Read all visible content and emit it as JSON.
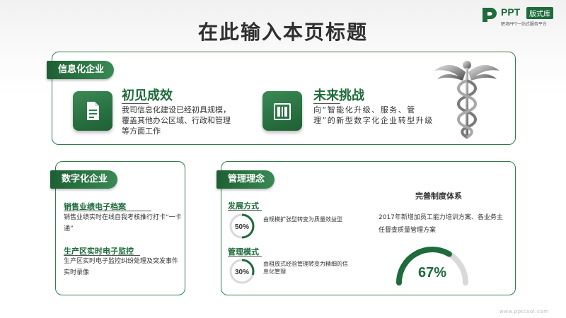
{
  "page": {
    "title": "在此输入本页标题",
    "footer_url": "www.pptcool.com"
  },
  "logo": {
    "brand": "PPT",
    "badge": "版式库",
    "subtitle": "职场PPT一站式服务平台"
  },
  "section1": {
    "tag": "信息化企业",
    "item1": {
      "icon": "document-icon",
      "title": "初见成效",
      "desc": "我司信息化建设已经初具规模，覆盖其他办公区域、行政和管理等方面工作"
    },
    "item2": {
      "icon": "book-icon",
      "title": "未来挑战",
      "desc": "向“智能化升级、服务、管理”的新型数字化企业转型升级"
    },
    "image": "caduceus-icon"
  },
  "section2": {
    "tag": "数字化企业",
    "item1": {
      "title": "销售业绩电子档案",
      "desc": "销售业绩实时在线自我考核推行打卡“一卡通”"
    },
    "item2": {
      "title": "生产区实时电子监控",
      "desc": "生产区实时电子监控纠纷处理及突发事件实时录像"
    }
  },
  "section3": {
    "tag": "管理理念",
    "mode1": {
      "title": "发展方式",
      "percent": 50,
      "percent_label": "50%",
      "desc": "由规模扩张型转变为质量效益型"
    },
    "mode2": {
      "title": "管理模式",
      "percent": 30,
      "percent_label": "30%",
      "desc": "由粗放式经验管理转变为精细的信息化管理"
    },
    "system": {
      "title": "完善制度体系",
      "desc": "2017年新增加员工能力培训方案、各业务主任督查质量管理方案",
      "percent": 67,
      "percent_label": "67%"
    }
  },
  "colors": {
    "accent": "#1e6b3b",
    "accent_light": "#3a8a55",
    "track": "#d9d9d9"
  }
}
